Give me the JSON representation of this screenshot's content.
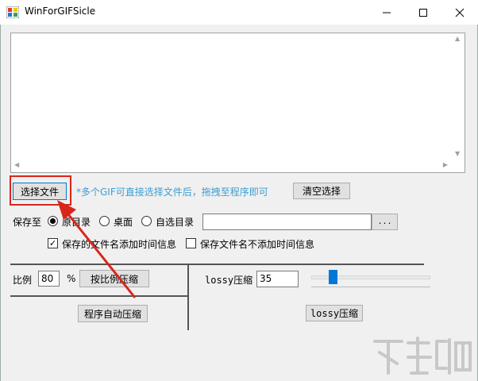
{
  "window": {
    "title": "WinForGIFSicle"
  },
  "listbox": {
    "items": []
  },
  "file": {
    "select_label": "选择文件",
    "hint": "*多个GIF可直接选择文件后，拖拽至程序即可",
    "clear_label": "清空选择"
  },
  "save": {
    "label": "保存至",
    "options": [
      "原目录",
      "桌面",
      "自选目录"
    ],
    "selected": "原目录",
    "path_value": "",
    "browse_label": "...",
    "add_time_label": "保存的文件名添加时间信息",
    "no_time_label": "保存文件名不添加时间信息"
  },
  "scale": {
    "label": "比例",
    "value": "80",
    "unit": "%",
    "button_label": "按比例压缩",
    "auto_label": "程序自动压缩"
  },
  "lossy": {
    "label": "lossy压缩",
    "value": "35",
    "button_label": "lossy压缩"
  },
  "colors": {
    "accent": "#0078d7",
    "hint": "#3b9ed6",
    "annotation": "#d9261c"
  }
}
